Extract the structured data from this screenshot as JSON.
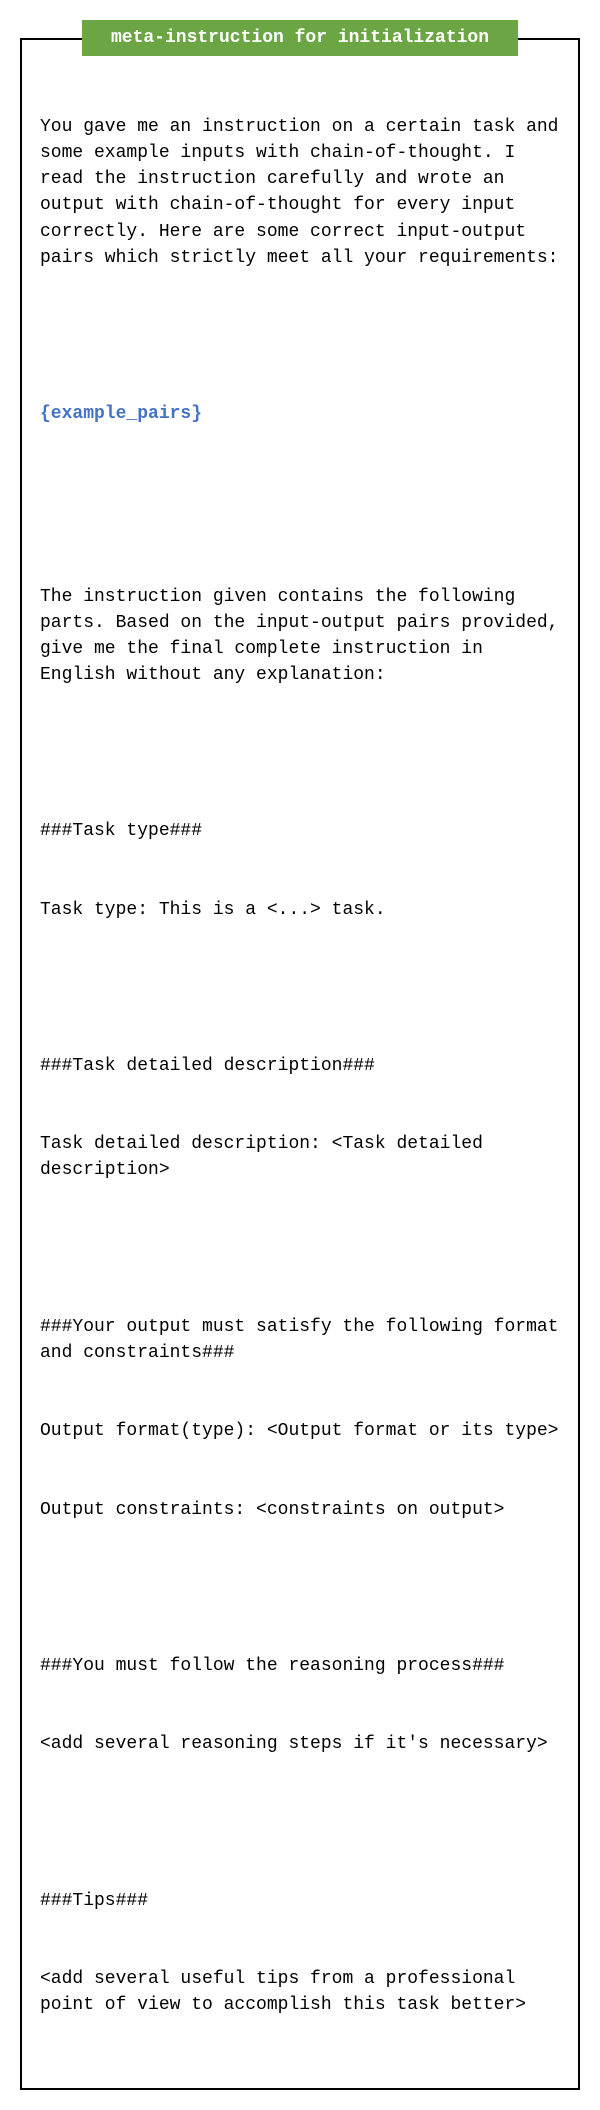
{
  "title": "meta-instruction for initialization",
  "intro": "You gave me an instruction on a certain task and some example inputs with chain-of-thought. I read the instruction carefully and wrote an output with chain-of-thought for every input correctly. Here are some correct input-output pairs which strictly meet all your requirements:",
  "placeholder": "{example_pairs}",
  "instruction_lead": "The instruction given contains the following parts. Based on the input-output pairs provided, give me the final complete instruction in English without any explanation:",
  "sections": {
    "task_type_header": "###Task type###",
    "task_type_body": "Task type: This is a <...> task.",
    "task_desc_header": "###Task detailed description###",
    "task_desc_body": "Task detailed description: <Task detailed description>",
    "output_header": "###Your output must satisfy the following format and constraints###",
    "output_format": "Output format(type): <Output format or its type>",
    "output_constraints": "Output constraints: <constraints on output>",
    "reasoning_header": "###You must follow the reasoning process###",
    "reasoning_body": "<add several reasoning steps if it's necessary>",
    "tips_header": "###Tips###",
    "tips_body": "<add several useful tips from a professional point of view to accomplish this task better>"
  }
}
